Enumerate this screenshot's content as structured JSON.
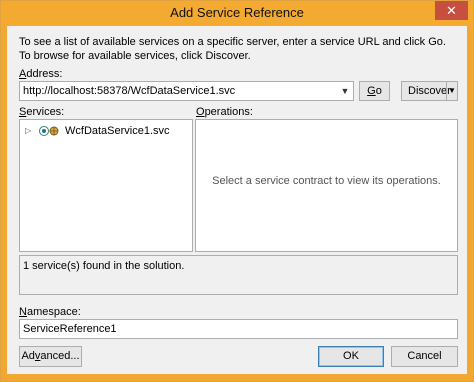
{
  "window": {
    "title": "Add Service Reference",
    "close_glyph": "✕"
  },
  "intro": "To see a list of available services on a specific server, enter a service URL and click Go. To browse for available services, click Discover.",
  "address": {
    "label_prefix": "",
    "label_key": "A",
    "label_rest": "ddress:",
    "value": "http://localhost:58378/WcfDataService1.svc",
    "go_key": "G",
    "go_rest": "o",
    "discover_label": "Discover"
  },
  "services": {
    "label_key": "S",
    "label_rest": "ervices:",
    "items": [
      {
        "label": "WcfDataService1.svc",
        "icon": "service-globe-icon"
      }
    ]
  },
  "operations": {
    "label_key": "O",
    "label_rest": "perations:",
    "placeholder": "Select a service contract to view its operations."
  },
  "status": "1 service(s) found in the solution.",
  "namespace": {
    "label_key": "N",
    "label_rest": "amespace:",
    "value": "ServiceReference1"
  },
  "buttons": {
    "advanced_prefix": "Ad",
    "advanced_key": "v",
    "advanced_rest": "anced...",
    "ok": "OK",
    "cancel": "Cancel"
  },
  "colors": {
    "titlebar": "#f4aa31",
    "close": "#c74f3f",
    "client": "#f0f0f0"
  }
}
